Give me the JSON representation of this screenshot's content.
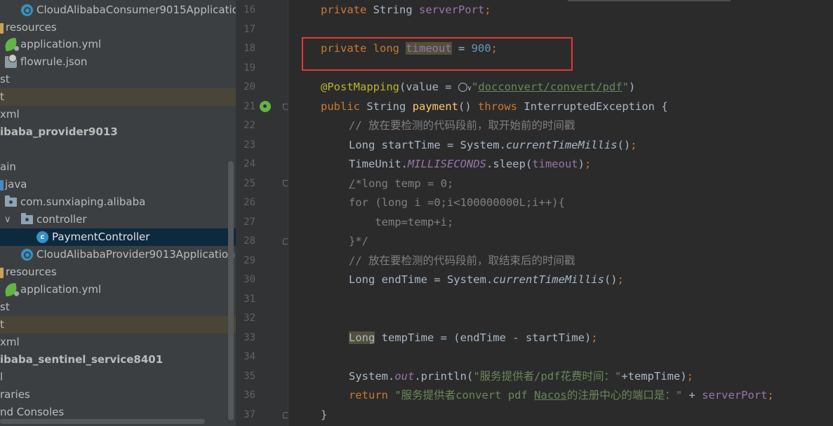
{
  "project_tree": {
    "items": [
      {
        "label": "CloudAlibabaConsumer9015Applicatio",
        "icon": "spring-boot-class-icon",
        "style": ""
      },
      {
        "label": "resources",
        "icon": "resources-folder-icon",
        "style": ""
      },
      {
        "label": "application.yml",
        "icon": "spring-config-icon",
        "style": ""
      },
      {
        "label": "flowrule.json",
        "icon": "json-file-icon",
        "style": ""
      },
      {
        "label": "st",
        "icon": "",
        "style": ""
      },
      {
        "label": "t",
        "icon": "",
        "style": "hl"
      },
      {
        "label": "xml",
        "icon": "",
        "style": ""
      },
      {
        "label": "ibaba_provider9013",
        "icon": "",
        "style": "bold"
      },
      {
        "label": "",
        "icon": "",
        "style": ""
      },
      {
        "label": "ain",
        "icon": "",
        "style": ""
      },
      {
        "label": "java",
        "icon": "source-folder-icon",
        "style": ""
      },
      {
        "label": "com.sunxiaping.alibaba",
        "icon": "package-folder-icon",
        "style": ""
      },
      {
        "label": "controller",
        "icon": "package-folder-icon",
        "style": ""
      },
      {
        "label": "PaymentController",
        "icon": "class-icon",
        "style": "sel"
      },
      {
        "label": "CloudAlibabaProvider9013Application",
        "icon": "spring-boot-class-icon",
        "style": ""
      },
      {
        "label": "resources",
        "icon": "resources-folder-icon",
        "style": ""
      },
      {
        "label": "application.yml",
        "icon": "spring-config-icon",
        "style": ""
      },
      {
        "label": "st",
        "icon": "",
        "style": ""
      },
      {
        "label": "t",
        "icon": "",
        "style": "hl"
      },
      {
        "label": "xml",
        "icon": "",
        "style": ""
      },
      {
        "label": "ibaba_sentinel_service8401",
        "icon": "",
        "style": "bold"
      },
      {
        "label": "l",
        "icon": "",
        "style": ""
      },
      {
        "label": "raries",
        "icon": "",
        "style": ""
      },
      {
        "label": "nd Consoles",
        "icon": "",
        "style": ""
      }
    ]
  },
  "editor": {
    "line_numbers": [
      "16",
      "17",
      "18",
      "19",
      "20",
      "21",
      "22",
      "23",
      "24",
      "25",
      "26",
      "27",
      "28",
      "29",
      "30",
      "31",
      "32",
      "33",
      "34",
      "35",
      "36",
      "37"
    ],
    "gutter_marker": "spring-bean-icon",
    "code": {
      "l16": {
        "kw": "private",
        "type": "String",
        "field": "serverPort",
        "end": ";"
      },
      "l18": {
        "kw1": "private",
        "kw2": "long",
        "field": "timeout",
        "op": " = ",
        "num": "900",
        "end": ";"
      },
      "l20": {
        "ann": "@PostMapping",
        "open": "(value = ",
        "str_open": "\"",
        "url": "docconvert/convert/pdf",
        "str_close": "\"",
        "close": ")"
      },
      "l21": {
        "kw": "public",
        "type": "String",
        "method": "payment",
        "parens": "()",
        "throws": "throws",
        "exc": "InterruptedException",
        "brace": "{"
      },
      "l22": "// 放在要检测的代码段前，取开始前的时间戳",
      "l23": {
        "a": "Long startTime = System.",
        "m": "currentTimeMillis",
        "b": "()",
        "end": ";"
      },
      "l24": {
        "a": "TimeUnit.",
        "c": "MILLISECONDS",
        "b": ".sleep(",
        "f": "timeout",
        "d": ")",
        "end": ";"
      },
      "l25": {
        "slash": "/",
        "rest": "*long temp = 0;"
      },
      "l26": "for (long i =0;i<100000000L;i++){",
      "l27": "    temp=temp+i;",
      "l28": "}*/",
      "l29": "// 放在要检测的代码段前，取结束后的时间戳",
      "l30": {
        "a": "Long endTime = System.",
        "m": "currentTimeMillis",
        "b": "()",
        "end": ";"
      },
      "l33": {
        "hl": "Long",
        "rest": " tempTime = (endTime - startTime)",
        "end": ";"
      },
      "l35": {
        "a": "System.",
        "out": "out",
        "b": ".println(",
        "str": "\"服务提供者/pdf花费时间：\"",
        "c": "+tempTime)",
        "end": ";"
      },
      "l36": {
        "kw": "return",
        "s1": "\"服务提供者convert pdf ",
        "s2": "Nacos",
        "s3": "的注册中心的端口是：\"",
        "plus": " + ",
        "field": "serverPort",
        "end": ";"
      },
      "l37": "}"
    }
  },
  "colors": {
    "keyword": "#cc7832",
    "string": "#6a8759",
    "comment": "#808080",
    "number": "#6897bb",
    "field": "#9876aa",
    "method": "#ffc66d",
    "annotation": "#bbb529",
    "highlight_box": "#e53935"
  }
}
